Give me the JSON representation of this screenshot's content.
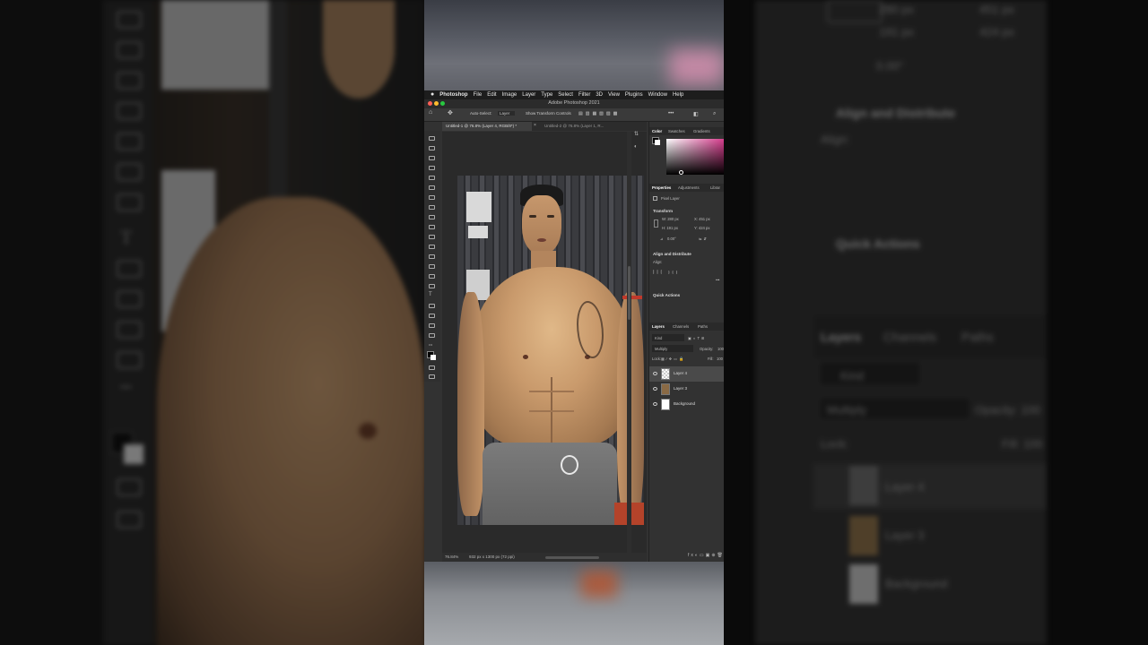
{
  "menubar": {
    "app_name": "Photoshop",
    "items": [
      "File",
      "Edit",
      "Image",
      "Layer",
      "Type",
      "Select",
      "Filter",
      "3D",
      "View",
      "Plugins",
      "Window",
      "Help"
    ]
  },
  "window": {
    "title": "Adobe Photoshop 2021"
  },
  "options_bar": {
    "auto_select_label": "Auto-Select:",
    "auto_select_value": "Layer",
    "transform_label": "Show Transform Controls"
  },
  "doc_tabs": [
    {
      "label": "Untitled-1 @ 76.8% (Layer 4, RGB/8*) *",
      "active": true
    },
    {
      "label": "Untitled-2 @ 76.8% (Layer 1, R...",
      "active": false
    }
  ],
  "status_bar": {
    "zoom": "76.84%",
    "doc_info": "932 px x 1300 px (72 ppi)"
  },
  "color_panel": {
    "tabs": [
      "Color",
      "Swatches",
      "Gradients"
    ],
    "hue_color": "#d63b8c"
  },
  "properties_panel": {
    "tabs": [
      "Properties",
      "Adjustments",
      "Librar"
    ],
    "layer_type": "Pixel Layer",
    "transform_title": "Transform",
    "w": "W: 280 px",
    "h": "H: 191 px",
    "x": "X: 451 px",
    "y": "Y: 424 px",
    "angle": "0.00°",
    "align_title": "Align and Distribute",
    "align_label": "Align:",
    "quick_actions_title": "Quick Actions"
  },
  "layers_panel": {
    "tabs": [
      "Layers",
      "Channels",
      "Paths"
    ],
    "kind_label": "Kind",
    "blend_mode": "Multiply",
    "opacity_label": "Opacity:",
    "opacity_value": "100",
    "lock_label": "Lock:",
    "fill_label": "Fill:",
    "fill_value": "100",
    "layers": [
      {
        "name": "Layer 4",
        "selected": true
      },
      {
        "name": "Layer 3",
        "selected": false
      },
      {
        "name": "Background",
        "selected": false
      }
    ]
  },
  "background_ghost": {
    "w_value": "280 px",
    "h_value": "191 px",
    "x_value": "451 px",
    "y_value": "424 px",
    "angle": "0.00°",
    "align_title": "Align and Distribute",
    "align_label": "Align:",
    "quick_actions_title": "Quick Actions",
    "layers_tab": "Layers",
    "channels_tab": "Channels",
    "paths_tab": "Paths",
    "kind_label": "Kind",
    "blend_mode": "Multiply",
    "opacity_label": "Opacity: 100",
    "lock_label": "Lock:",
    "fill_label": "Fill: 100",
    "layer4": "Layer 4",
    "layer3": "Layer 3",
    "background": "Background"
  },
  "colors": {
    "ps_bg": "#323232",
    "ps_dark": "#2a2a2a",
    "accent_pink": "#d63b8c"
  }
}
